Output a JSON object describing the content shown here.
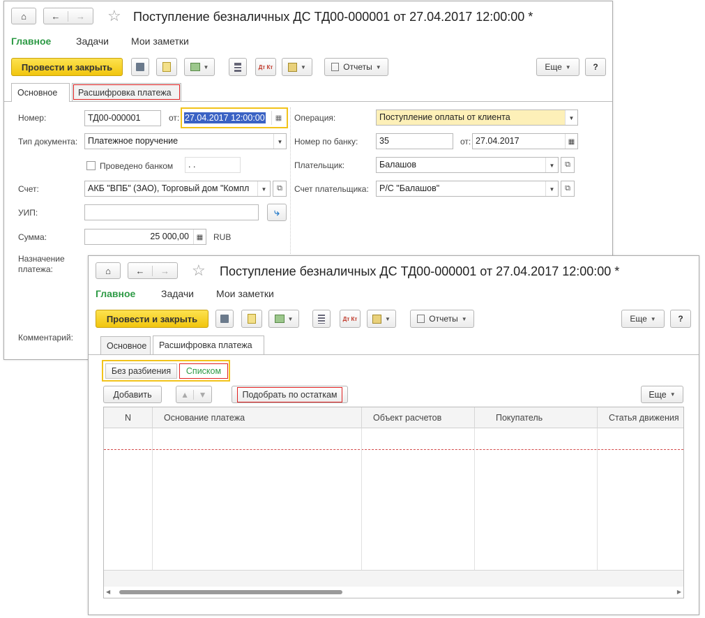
{
  "document": {
    "title": "Поступление безналичных ДС ТД00-000001 от 27.04.2017 12:00:00 *",
    "sections": [
      "Главное",
      "Задачи",
      "Мои заметки"
    ]
  },
  "toolbar": {
    "post_close_label": "Провести и закрыть",
    "reports_label": "Отчеты",
    "more_label": "Еще",
    "help_label": "?",
    "dtkt_label": "Дт Кт"
  },
  "tabs": [
    "Основное",
    "Расшифровка платежа"
  ],
  "form": {
    "number_label": "Номер:",
    "number_value": "ТД00-000001",
    "from_label": "от:",
    "date_value": "27.04.2017 12:00:00",
    "doc_type_label": "Тип документа:",
    "doc_type_value": "Платежное поручение",
    "bank_checkbox_label": "Проведено банком",
    "bank_date_value": " .  .",
    "account_label": "Счет:",
    "account_value": "АКБ \"ВПБ\" (ЗАО), Торговый дом \"Компл",
    "uip_label": "УИП:",
    "uip_value": "",
    "sum_label": "Сумма:",
    "sum_value": "25 000,00",
    "currency": "RUB",
    "purpose_label_1": "Назначение",
    "purpose_label_2": "платежа:",
    "comment_label": "Комментарий:",
    "operation_label": "Операция:",
    "operation_value": "Поступление оплаты от клиента",
    "bank_number_label": "Номер по банку:",
    "bank_number_value": "35",
    "bank_from_label": "от:",
    "bank_date": "27.04.2017",
    "payer_label": "Плательщик:",
    "payer_value": "Балашов",
    "payer_account_label": "Счет плательщика:",
    "payer_account_value": "Р/С \"Балашов\""
  },
  "breakdown": {
    "mode_options": [
      "Без разбиения",
      "Списком"
    ],
    "add_label": "Добавить",
    "pick_label": "Подобрать по остаткам",
    "more_label": "Еще",
    "columns": [
      "N",
      "Основание платежа",
      "Объект расчетов",
      "Покупатель",
      "Статья движения"
    ]
  },
  "colors": {
    "accent_green": "#2d9a45",
    "button_yellow": "#f6d22c",
    "highlight_red": "#e02020",
    "focus_yellow": "#f2c31a"
  }
}
